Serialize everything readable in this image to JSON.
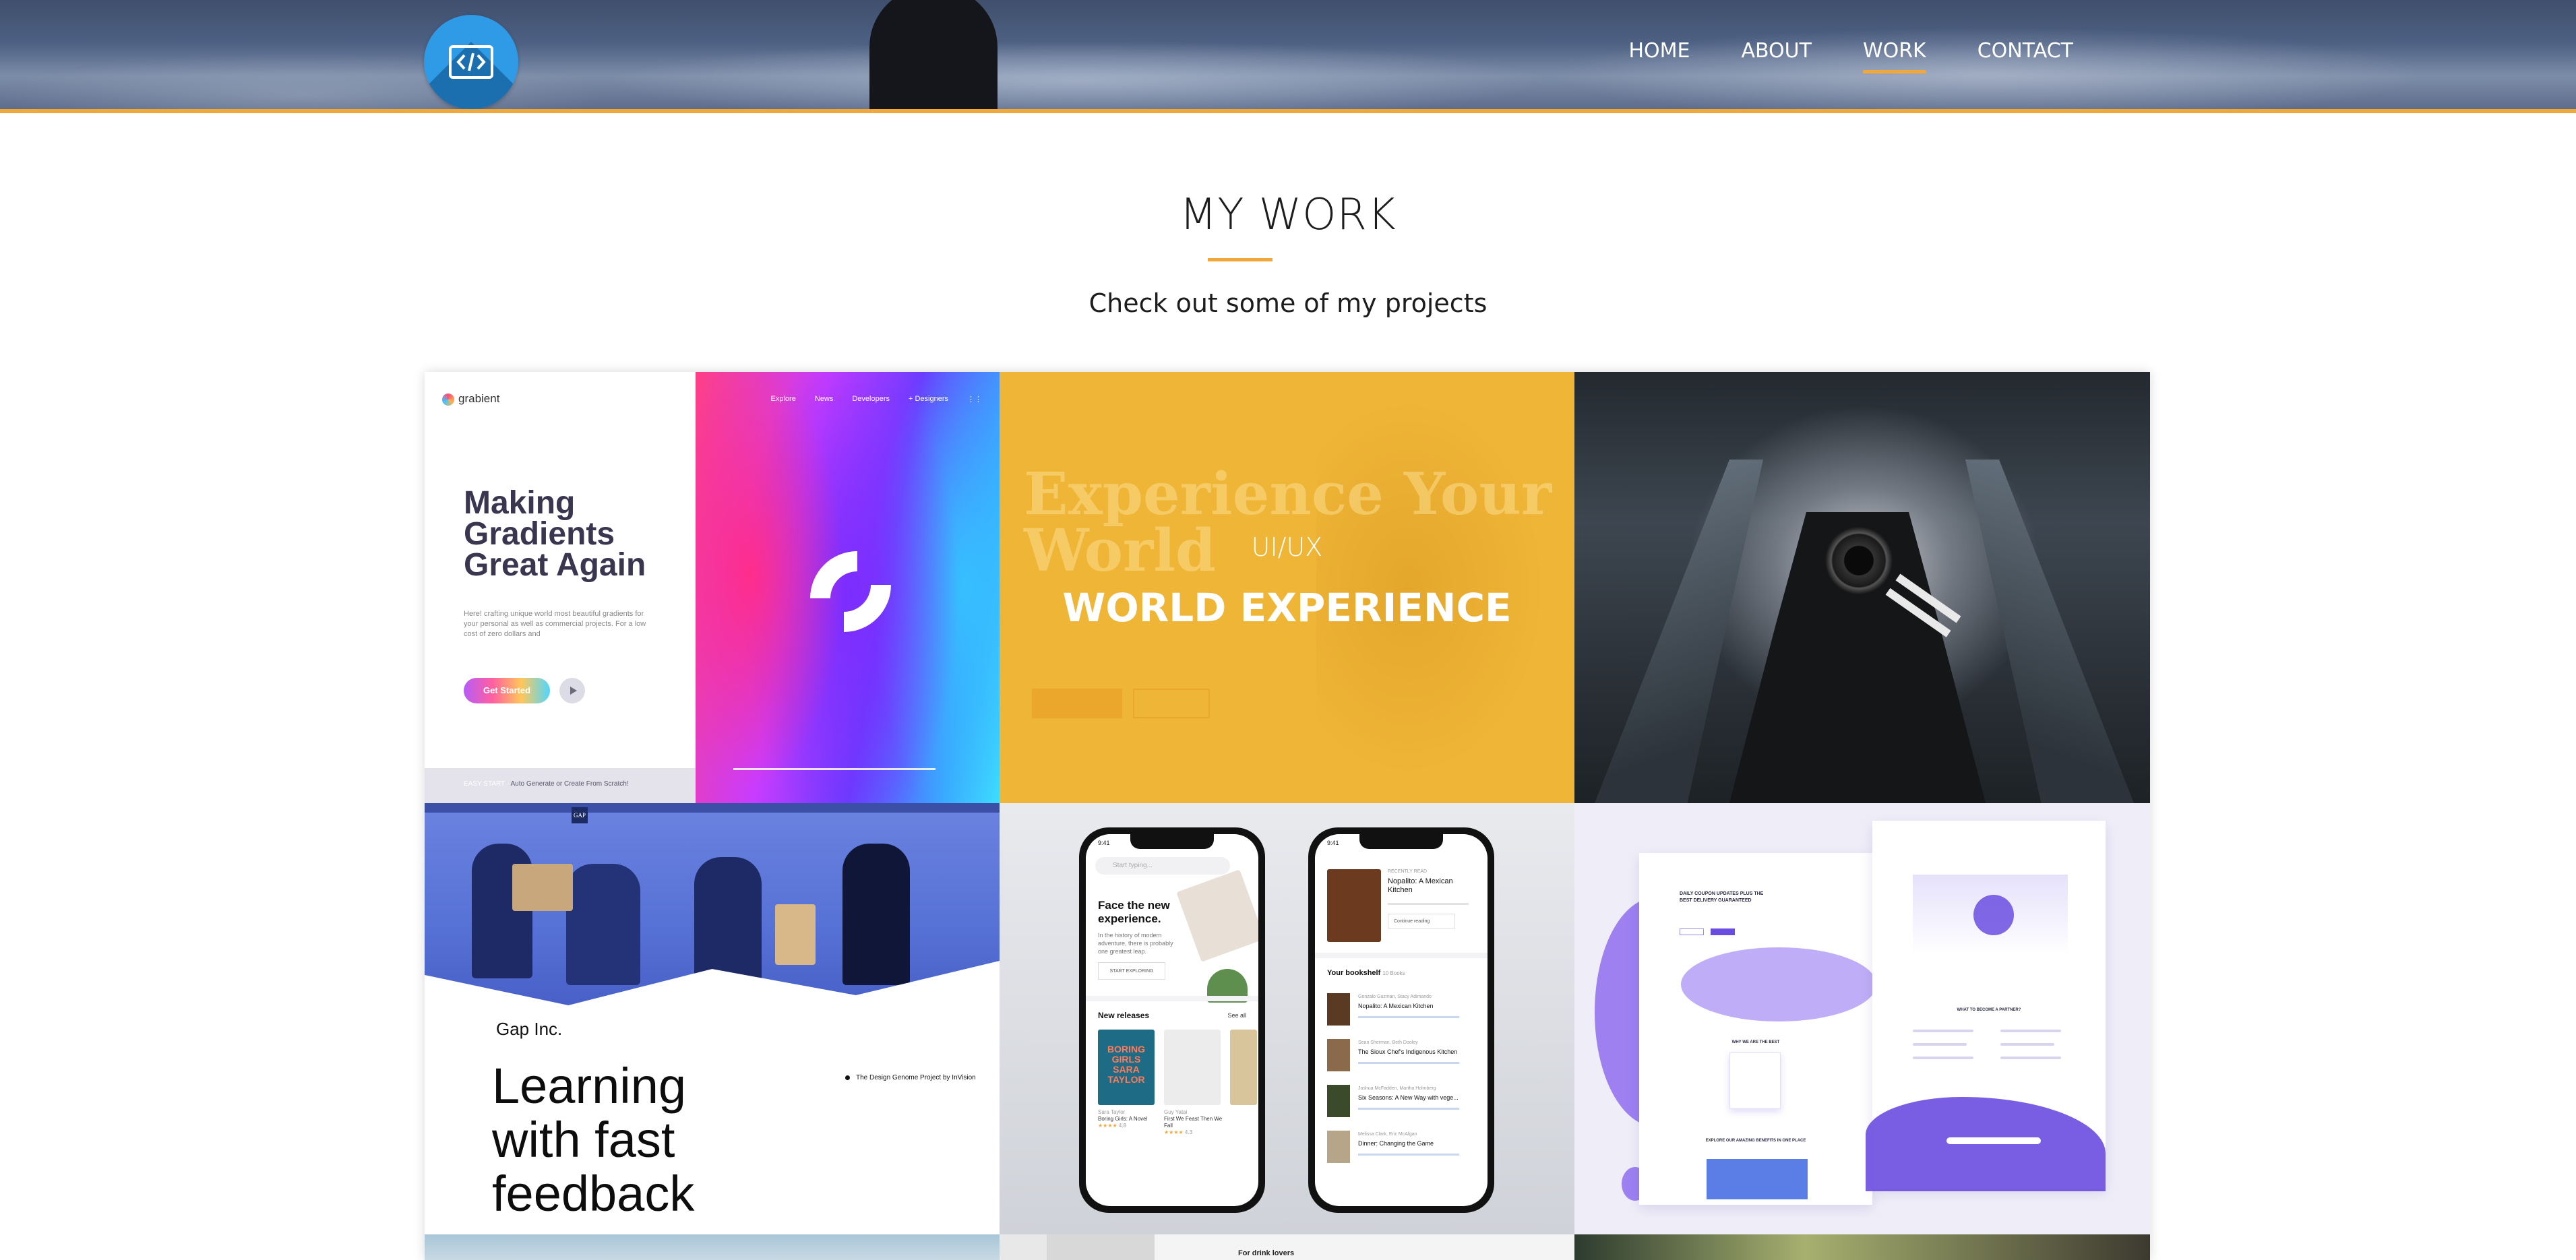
{
  "nav": {
    "logo_icon": "code-brackets-icon",
    "items": [
      {
        "label": "HOME",
        "active": false
      },
      {
        "label": "ABOUT",
        "active": false
      },
      {
        "label": "WORK",
        "active": true
      },
      {
        "label": "CONTACT",
        "active": false
      }
    ]
  },
  "colors": {
    "accent": "#f0a83a",
    "logo_blue": "#2f9be6",
    "header_bg": "#4e6184",
    "text": "#1d1d1d"
  },
  "section": {
    "title": "MY WORK",
    "subtitle": "Check out some of my projects"
  },
  "projects": [
    {
      "brand": "grabient",
      "headline": "Making Gradients Great Again",
      "body": "Here! crafting unique world most beautiful gradients for your personal as well as commercial projects. For a low cost of zero dollars and",
      "button": "Get Started",
      "mini_nav": [
        "Explore",
        "News",
        "Developers",
        "+ Designers"
      ],
      "footer": "EASY START",
      "footer_note": "Auto Generate or Create From Scratch!"
    },
    {
      "category": "UI/UX",
      "name": "WORLD EXPERIENCE",
      "background_text": "Experience Your World",
      "hovered": true
    },
    {
      "image": "photographer-escalator"
    },
    {
      "company": "Gap Inc.",
      "headline": "Learning with fast feedback",
      "note": "The Design Genome Project by InVision",
      "logo": "GAP"
    },
    {
      "phone1": {
        "search_placeholder": "Start typing...",
        "heading": "Face the new experience.",
        "body": "In the history of modern adventure, there is probably one greatest leap.",
        "button": "START EXPLORING",
        "section": "New releases",
        "see_all": "See all",
        "books": [
          {
            "author": "Sara Taylor",
            "title": "Boring Girls: A Novel",
            "rating": "4.8"
          },
          {
            "author": "Guy Yatai",
            "title": "First We Feast Then We Fall",
            "rating": "4.3"
          }
        ],
        "cover_text": "BORING GIRLS SARA TAYLOR",
        "time": "9:41"
      },
      "phone2": {
        "recent": "RECENTLY READ",
        "current": "Nopalito: A Mexican Kitchen",
        "continue": "Continue reading",
        "section": "Your bookshelf",
        "count": "10 Books",
        "books": [
          {
            "author": "Gonzalo Guzman, Stacy Adimando",
            "title": "Nopalito: A Mexican Kitchen"
          },
          {
            "author": "Sean Sherman, Beth Dooley",
            "title": "The Sioux Chef's Indigenous Kitchen"
          },
          {
            "author": "Joshua McFadden, Martha Holmberg",
            "title": "Six Seasons: A New Way with vege..."
          },
          {
            "author": "Melissa Clark, Eric McAfgan",
            "title": "Dinner: Changing the Game"
          }
        ],
        "time": "9:41"
      }
    },
    {
      "image": "landing-page-mockup",
      "headline": "DAILY COUPON UPDATES PLUS THE BEST DELIVERY GUARANTEED",
      "section1": "WHY WE ARE THE BEST",
      "section2": "WHAT TO BECOME A PARTNER?",
      "section3": "EXPLORE OUR AMAZING BENEFITS IN ONE PLACE"
    },
    {
      "image": "landscape-sky"
    },
    {
      "title": "For drink lovers"
    },
    {
      "image": "people-outdoors"
    }
  ]
}
